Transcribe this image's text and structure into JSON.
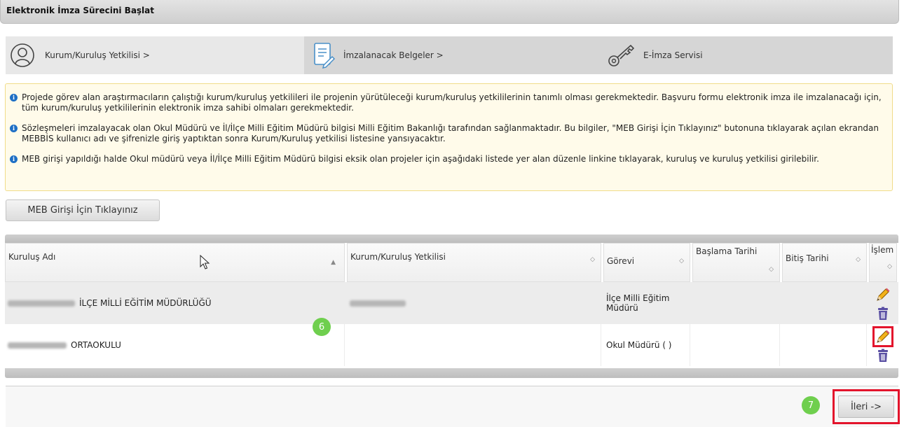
{
  "header": {
    "title": "Elektronik İmza Sürecini Başlat"
  },
  "wizard": {
    "steps": [
      {
        "label": "Kurum/Kuruluş Yetkilisi >",
        "icon": "user-icon"
      },
      {
        "label": "İmzalanacak Belgeler >",
        "icon": "document-edit-icon"
      },
      {
        "label": "E-İmza Servisi",
        "icon": "key-icon"
      }
    ]
  },
  "info": {
    "lines": [
      "Projede görev alan araştırmacıların çalıştığı kurum/kuruluş yetkilileri ile projenin yürütüleceği kurum/kuruluş yetkililerinin tanımlı olması gerekmektedir. Başvuru formu elektronik imza ile imzalanacağı için, tüm kurum/kuruluş yetkililerinin elektronik imza sahibi olmaları gerekmektedir.",
      "Sözleşmeleri imzalayacak olan Okul Müdürü ve İl/İlçe Milli Eğitim Müdürü bilgisi Milli Eğitim Bakanlığı tarafından sağlanmaktadır. Bu bilgiler, \"MEB Girişi İçin Tıklayınız\" butonuna tıklayarak açılan ekrandan MEBBİS kullanıcı adı ve şifrenizle giriş yaptıktan sonra Kurum/Kuruluş yetkilisi listesine yansıyacaktır.",
      "MEB girişi yapıldığı halde Okul müdürü veya İl/İlçe Milli Eğitim Müdürü bilgisi eksik olan projeler için aşağıdaki listede yer alan düzenle linkine tıklayarak, kuruluş ve kuruluş yetkilisi girilebilir."
    ]
  },
  "meb_button": {
    "label": "MEB Girişi İçin Tıklayınız"
  },
  "table": {
    "columns": [
      "Kuruluş Adı",
      "Kurum/Kuruluş Yetkilisi",
      "Görevi",
      "Başlama Tarihi",
      "Bitiş Tarihi",
      "İşlem"
    ],
    "rows": [
      {
        "kurulus_adi": "İLÇE MİLLİ EĞİTİM MÜDÜRLÜĞÜ",
        "yetkili": "",
        "gorevi": "İlçe Milli Eğitim Müdürü",
        "baslama": "",
        "bitis": ""
      },
      {
        "kurulus_adi": "ORTAOKULU",
        "yetkili": "",
        "gorevi": "Okul Müdürü ( )",
        "baslama": "",
        "bitis": ""
      }
    ]
  },
  "badges": {
    "step6": "6",
    "step7": "7"
  },
  "footer": {
    "next_label": "İleri ->"
  },
  "colors": {
    "highlight": "#e3142c",
    "badge": "#6fcf4e",
    "info_bg": "#fffbea",
    "info_icon": "#1e6fc5"
  }
}
